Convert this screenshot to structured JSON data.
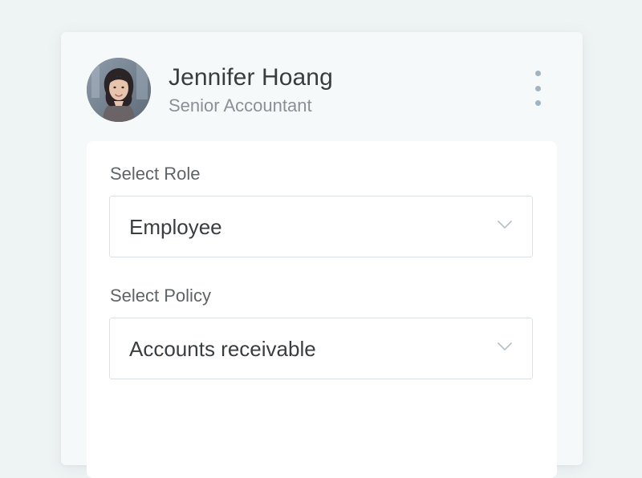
{
  "profile": {
    "name": "Jennifer Hoang",
    "title": "Senior Accountant",
    "avatar_icon": "user-photo"
  },
  "menu": {
    "icon": "more-vertical-icon"
  },
  "role": {
    "label": "Select Role",
    "value": "Employee"
  },
  "policy": {
    "label": "Select Policy",
    "value": "Accounts receivable"
  },
  "colors": {
    "page_background": "#eef3f4",
    "card_background": "#f5f9fa",
    "panel_background": "#ffffff",
    "accent_dots": "#9fb5c4"
  }
}
